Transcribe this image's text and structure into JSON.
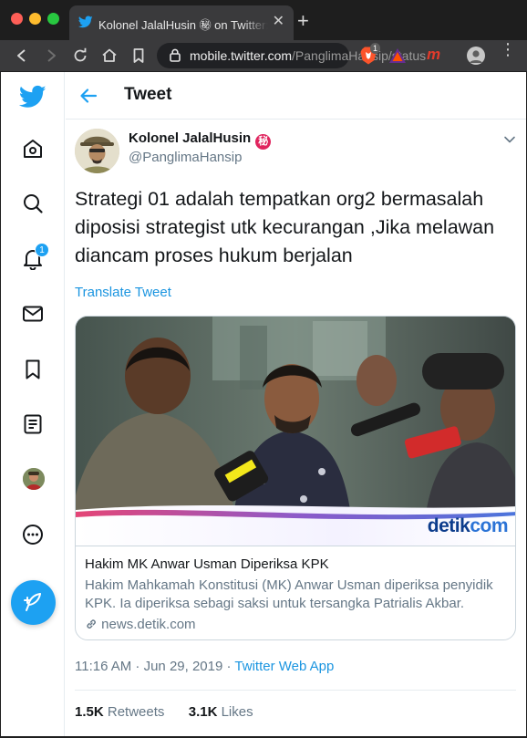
{
  "browser": {
    "tab_title": "Kolonel JalalHusin ㊙ on Twitter: \"S",
    "tab_close": "✕",
    "new_tab": "+",
    "url_host": "mobile.twitter.com",
    "url_path": "/PanglimaHansip/status",
    "extension_badge_count": "1",
    "extension_m": "m"
  },
  "sidebar": {
    "notification_badge": "1",
    "items": [
      "twitter-logo",
      "home-icon",
      "search-icon",
      "notifications-icon",
      "messages-icon",
      "bookmarks-icon",
      "lists-icon",
      "profile-avatar",
      "more-icon"
    ]
  },
  "header": {
    "title": "Tweet"
  },
  "tweet": {
    "author_name": "Kolonel JalalHusin",
    "author_emoji": "秘",
    "author_handle": "@PanglimaHansip",
    "text": "Strategi 01 adalah tempatkan org2 bermasalah diposisi strategist utk kecurangan ,Jika melawan diancam proses hukum berjalan",
    "translate_label": "Translate Tweet",
    "timestamp": "11:16 AM · Jun 29, 2019 · ",
    "source": "Twitter Web App",
    "retweets_count": "1.5K",
    "retweets_label": " Retweets",
    "likes_count": "3.1K",
    "likes_label": " Likes"
  },
  "card": {
    "brand_detik": "detik",
    "brand_com": "com",
    "title": "Hakim MK Anwar Usman Diperiksa KPK",
    "description": "Hakim Mahkamah Konstitusi (MK) Anwar Usman diperiksa penyidik KPK. Ia diperiksa sebagi saksi untuk tersangka Patrialis Akbar.",
    "domain": "news.detik.com"
  },
  "colors": {
    "accent": "#1da1f2",
    "link": "#1b95e0",
    "muted": "#657786",
    "text": "#14171a"
  }
}
